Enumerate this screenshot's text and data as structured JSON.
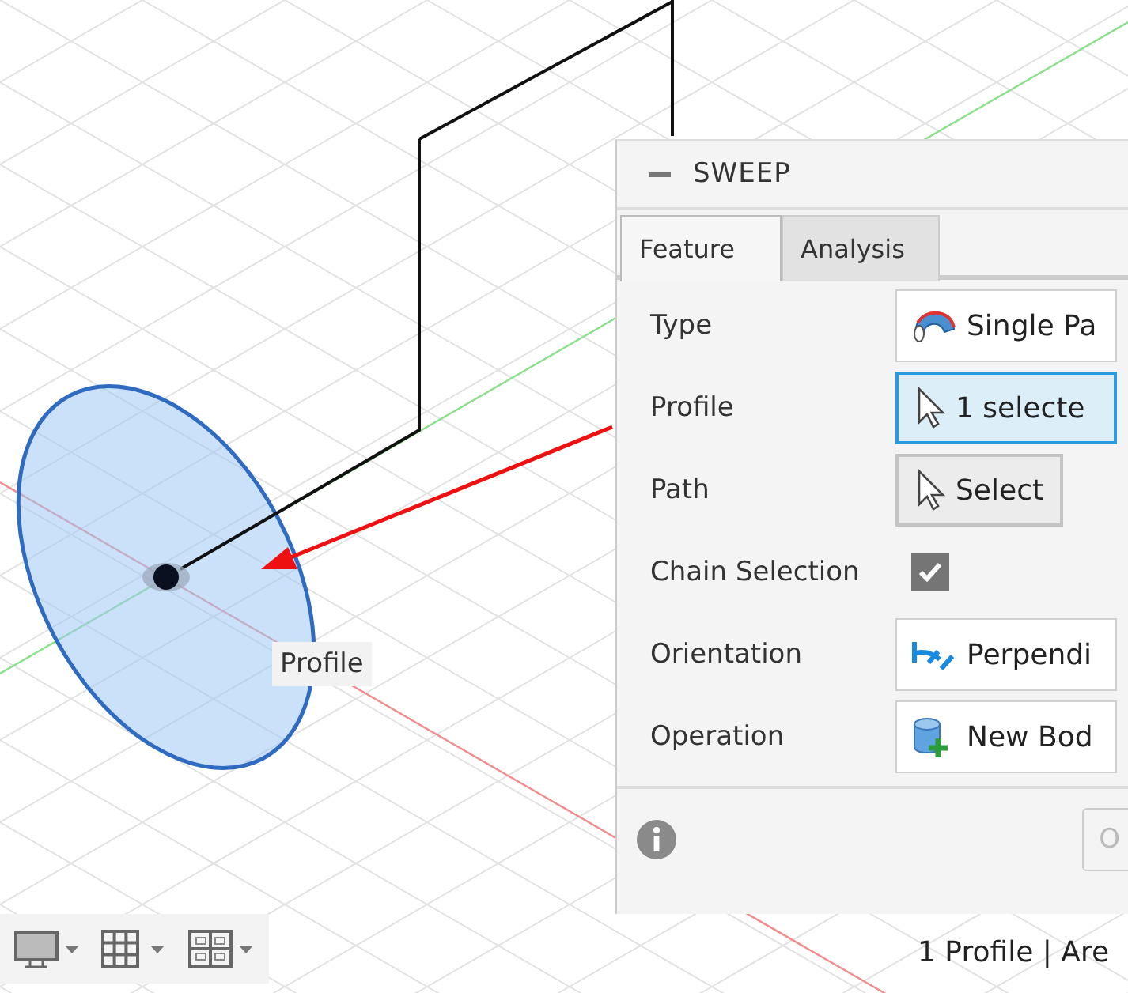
{
  "panel": {
    "title": "SWEEP",
    "tabs": [
      {
        "label": "Feature",
        "selected": true
      },
      {
        "label": "Analysis",
        "selected": false
      }
    ],
    "rows": [
      {
        "kind": "dropdown",
        "label": "Type",
        "value": "Single Pa"
      },
      {
        "kind": "selection",
        "label": "Profile",
        "value": "1 selecte",
        "selected": true
      },
      {
        "kind": "selection",
        "label": "Path",
        "value": "Select",
        "selected": false
      },
      {
        "kind": "checkbox",
        "label": "Chain Selection",
        "checked": true
      },
      {
        "kind": "dropdown",
        "label": "Orientation",
        "value": "Perpendi"
      },
      {
        "kind": "dropdown",
        "label": "Operation",
        "value": "New Bod"
      }
    ],
    "ok_button": "O"
  },
  "tooltip": "Profile",
  "status": "1 Profile | Are"
}
